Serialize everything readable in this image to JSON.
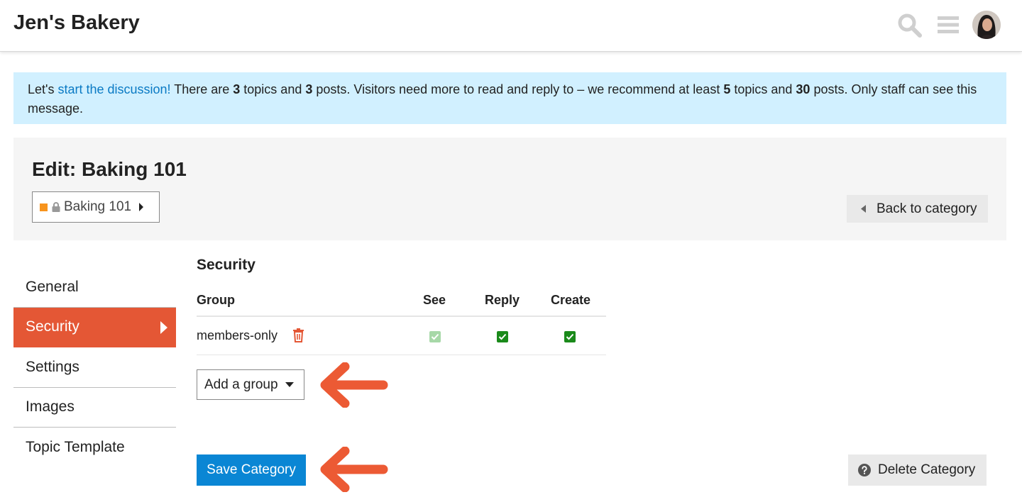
{
  "header": {
    "site_title": "Jen's Bakery",
    "icons": [
      "search-icon",
      "menu-icon",
      "avatar"
    ]
  },
  "notice": {
    "prefix": "Let's ",
    "link_text": "start the discussion!",
    "text1": " There are ",
    "topics_count": "3",
    "text2": " topics and ",
    "posts_count": "3",
    "text3": " posts. Visitors need more to read and reply to – we recommend at least ",
    "rec_topics": "5",
    "text4": " topics and ",
    "rec_posts": "30",
    "text5": " posts. Only staff can see this message.",
    "background_color": "#d1f0ff",
    "link_color": "#0a7ac4"
  },
  "edit": {
    "title": "Edit: Baking 101",
    "category_badge": {
      "name": "Baking 101",
      "color": "#f7941d",
      "icons": [
        "lock-icon",
        "caret-right-icon"
      ]
    },
    "back_button_label": "Back to category"
  },
  "nav": {
    "items": [
      {
        "label": "General",
        "active": false
      },
      {
        "label": "Security",
        "active": true
      },
      {
        "label": "Settings",
        "active": false
      },
      {
        "label": "Images",
        "active": false
      },
      {
        "label": "Topic Template",
        "active": false
      }
    ],
    "active_color": "#e45735"
  },
  "security": {
    "heading": "Security",
    "columns": [
      "Group",
      "See",
      "Reply",
      "Create"
    ],
    "rows": [
      {
        "group": "members-only",
        "see": true,
        "see_disabled": true,
        "reply": true,
        "create": true
      }
    ],
    "add_group_label": "Add a group"
  },
  "actions": {
    "save_label": "Save Category",
    "delete_label": "Delete Category",
    "save_color": "#0a86d4"
  },
  "annotation_arrow_color": "#ec5a34"
}
